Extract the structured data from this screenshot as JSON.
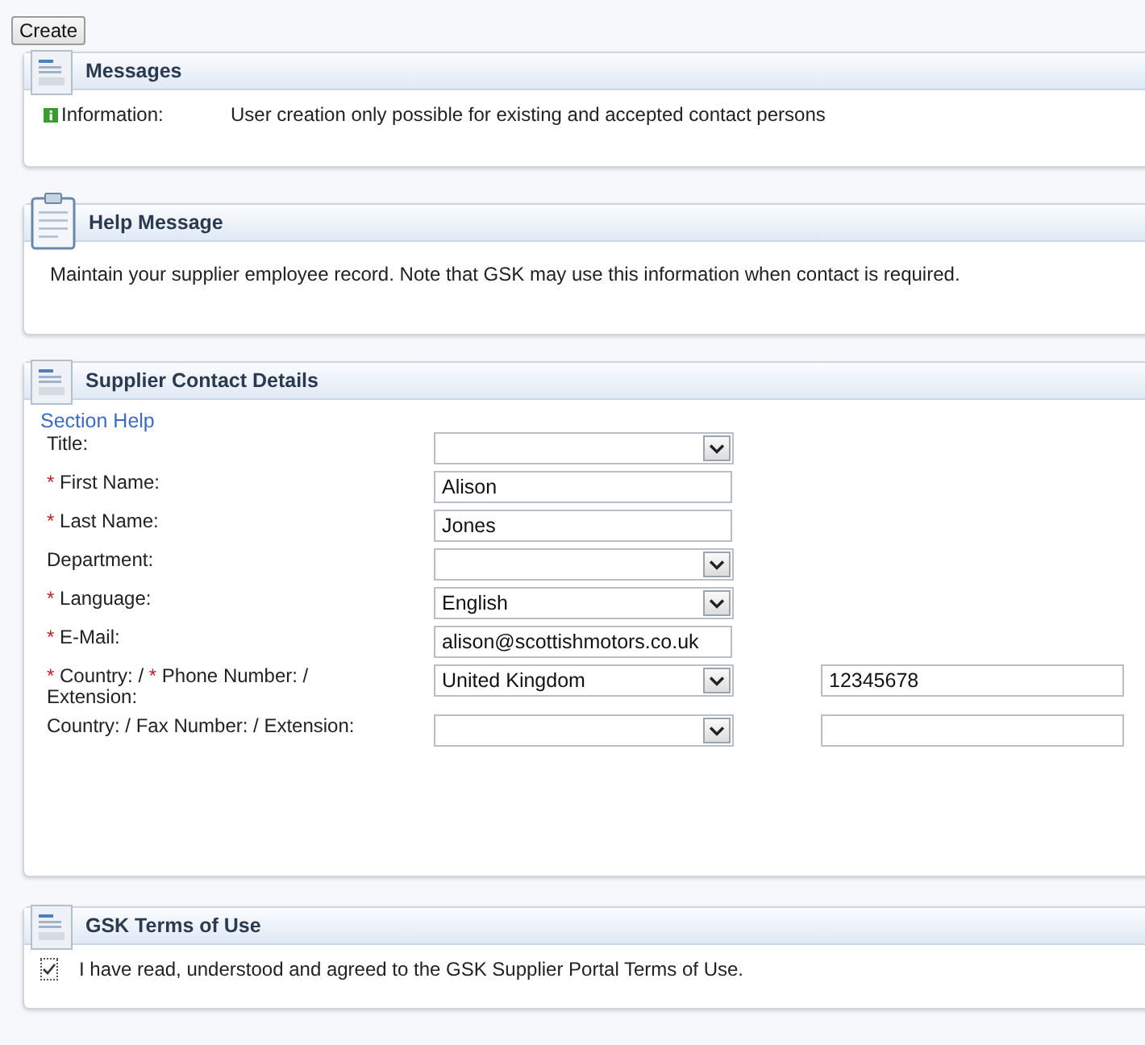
{
  "toolbar": {
    "button": "Create"
  },
  "messages": {
    "title": "Messages",
    "items": [
      {
        "type": "Information:",
        "text": "User creation only possible for existing and accepted contact persons"
      }
    ]
  },
  "help": {
    "title": "Help Message",
    "text": "Maintain your supplier employee record. Note that GSK may use this information when contact is required."
  },
  "contact": {
    "title": "Supplier Contact Details",
    "section_help": "Section Help",
    "fields": [
      {
        "label_parts": [
          {
            "kind": "text",
            "text": "Title:"
          }
        ],
        "controls": [
          {
            "kind": "select"
          }
        ]
      },
      {
        "label_parts": [
          {
            "kind": "mark",
            "text": "*"
          },
          {
            "kind": "text",
            "text": "First Name:"
          }
        ],
        "controls": [
          {
            "kind": "text",
            "value": "Alison"
          }
        ]
      },
      {
        "label_parts": [
          {
            "kind": "mark",
            "text": "*"
          },
          {
            "kind": "text",
            "text": "Last Name:"
          }
        ],
        "controls": [
          {
            "kind": "text",
            "value": "Jones"
          }
        ]
      },
      {
        "label_parts": [
          {
            "kind": "text",
            "text": "Department:"
          }
        ],
        "controls": [
          {
            "kind": "select"
          }
        ]
      },
      {
        "label_parts": [
          {
            "kind": "mark",
            "text": "*"
          },
          {
            "kind": "text",
            "text": "Language:"
          }
        ],
        "controls": [
          {
            "kind": "select",
            "value": "English"
          }
        ]
      },
      {
        "label_parts": [
          {
            "kind": "mark",
            "text": "*"
          },
          {
            "kind": "text",
            "text": "E-Mail:"
          }
        ],
        "controls": [
          {
            "kind": "text",
            "value": "alison@scottishmotors.co.uk"
          }
        ]
      },
      {
        "label_parts": [
          {
            "kind": "mark",
            "text": "*"
          },
          {
            "kind": "text",
            "text": "Country: /"
          },
          {
            "kind": "mark",
            "text": "*"
          },
          {
            "kind": "text",
            "text": "Phone Number: / Extension:"
          }
        ],
        "controls": [
          {
            "kind": "select",
            "value": "United Kingdom"
          },
          {
            "kind": "text",
            "value": "12345678"
          }
        ]
      },
      {
        "label_parts": [
          {
            "kind": "text",
            "text": "Country: / Fax Number: / Extension:"
          }
        ],
        "controls": [
          {
            "kind": "select"
          },
          {
            "kind": "text"
          }
        ]
      }
    ]
  },
  "terms": {
    "title": "GSK Terms of Use",
    "checked": true,
    "text": "I have read, understood and agreed to the GSK Supplier Portal Terms of Use."
  }
}
